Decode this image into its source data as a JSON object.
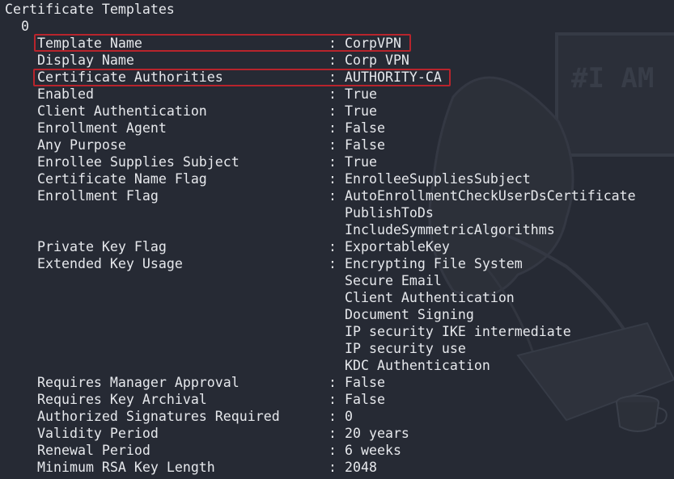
{
  "section_title": "Certificate Templates",
  "index": "0",
  "entries": [
    {
      "key": "Template Name",
      "values": [
        "CorpVPN"
      ],
      "highlighted": true
    },
    {
      "key": "Display Name",
      "values": [
        "Corp VPN"
      ]
    },
    {
      "key": "Certificate Authorities",
      "values": [
        "AUTHORITY-CA"
      ],
      "highlighted": true
    },
    {
      "key": "Enabled",
      "values": [
        "True"
      ]
    },
    {
      "key": "Client Authentication",
      "values": [
        "True"
      ]
    },
    {
      "key": "Enrollment Agent",
      "values": [
        "False"
      ]
    },
    {
      "key": "Any Purpose",
      "values": [
        "False"
      ]
    },
    {
      "key": "Enrollee Supplies Subject",
      "values": [
        "True"
      ]
    },
    {
      "key": "Certificate Name Flag",
      "values": [
        "EnrolleeSuppliesSubject"
      ]
    },
    {
      "key": "Enrollment Flag",
      "values": [
        "AutoEnrollmentCheckUserDsCertificate",
        "PublishToDs",
        "IncludeSymmetricAlgorithms"
      ]
    },
    {
      "key": "Private Key Flag",
      "values": [
        "ExportableKey"
      ]
    },
    {
      "key": "Extended Key Usage",
      "values": [
        "Encrypting File System",
        "Secure Email",
        "Client Authentication",
        "Document Signing",
        "IP security IKE intermediate",
        "IP security use",
        "KDC Authentication"
      ]
    },
    {
      "key": "Requires Manager Approval",
      "values": [
        "False"
      ]
    },
    {
      "key": "Requires Key Archival",
      "values": [
        "False"
      ]
    },
    {
      "key": "Authorized Signatures Required",
      "values": [
        "0"
      ]
    },
    {
      "key": "Validity Period",
      "values": [
        "20 years"
      ]
    },
    {
      "key": "Renewal Period",
      "values": [
        "6 weeks"
      ]
    },
    {
      "key": "Minimum RSA Key Length",
      "values": [
        "2048"
      ]
    }
  ],
  "wallpaper_text": "#I AM",
  "colors": {
    "background": "#262a34",
    "foreground": "#e6e8ec",
    "highlight_border": "#b8242c"
  }
}
